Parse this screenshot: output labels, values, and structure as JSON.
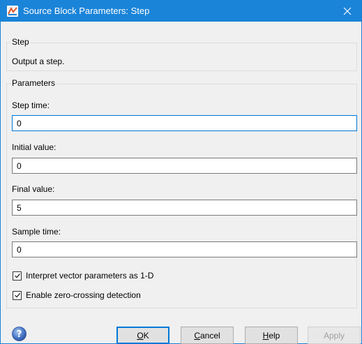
{
  "window": {
    "title": "Source Block Parameters: Step"
  },
  "block_group": {
    "legend": "Step",
    "description": "Output a step."
  },
  "params_group": {
    "legend": "Parameters"
  },
  "fields": [
    {
      "label": "Step time:",
      "value": "0"
    },
    {
      "label": "Initial value:",
      "value": "0"
    },
    {
      "label": "Final value:",
      "value": "5"
    },
    {
      "label": "Sample time:",
      "value": "0"
    }
  ],
  "checkboxes": [
    {
      "label": "Interpret vector parameters as 1-D",
      "checked": true
    },
    {
      "label": "Enable zero-crossing detection",
      "checked": true
    }
  ],
  "buttons": {
    "ok": {
      "access": "O",
      "rest": "K"
    },
    "cancel": {
      "access": "C",
      "rest": "ancel"
    },
    "help": {
      "access": "H",
      "rest": "elp"
    },
    "apply": {
      "label": "Apply"
    }
  },
  "colors": {
    "titlebar": "#1a84d8",
    "focus": "#0078d7",
    "background": "#f0f0f0"
  }
}
